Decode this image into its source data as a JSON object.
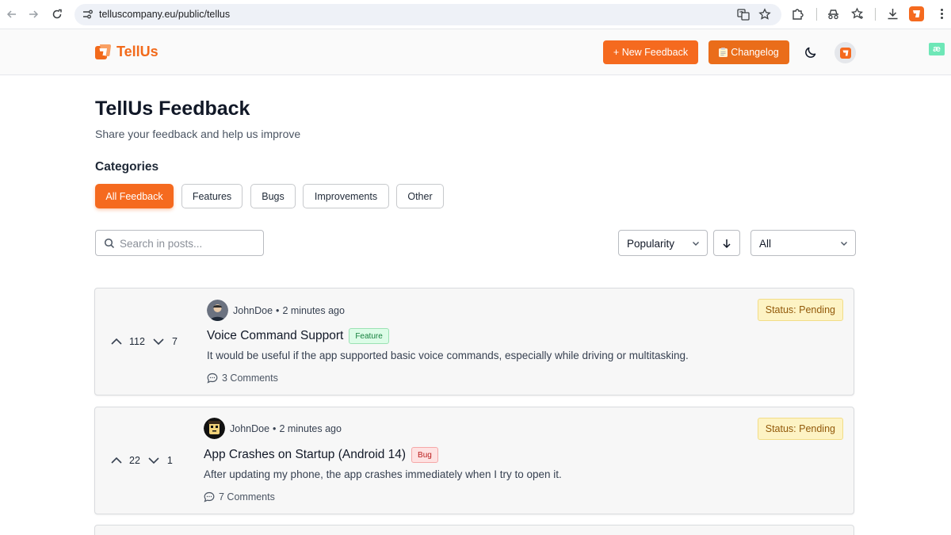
{
  "browser": {
    "url": "telluscompany.eu/public/tellus"
  },
  "header": {
    "brand": "TellUs",
    "new_feedback": "+ New Feedback",
    "changelog": "Changelog",
    "changelog_icon": "clipboard-icon",
    "theme_icon": "moon-icon"
  },
  "page": {
    "title": "TellUs Feedback",
    "subtitle": "Share your feedback and help us improve"
  },
  "categories": {
    "heading": "Categories",
    "items": [
      {
        "label": "All Feedback",
        "active": true
      },
      {
        "label": "Features",
        "active": false
      },
      {
        "label": "Bugs",
        "active": false
      },
      {
        "label": "Improvements",
        "active": false
      },
      {
        "label": "Other",
        "active": false
      }
    ]
  },
  "filters": {
    "search_placeholder": "Search in posts...",
    "sort_by": "Popularity",
    "status_filter": "All"
  },
  "posts": [
    {
      "upvotes": "112",
      "downvotes": "7",
      "author": "JohnDoe",
      "time": "2 minutes ago",
      "status": "Status: Pending",
      "title": "Voice Command Support",
      "tag": "Feature",
      "description": "It would be useful if the app supported basic voice commands, especially while driving or multitasking.",
      "comments": "3 Comments"
    },
    {
      "upvotes": "22",
      "downvotes": "1",
      "author": "JohnDoe",
      "time": "2 minutes ago",
      "status": "Status: Pending",
      "title": "App Crashes on Startup (Android 14)",
      "tag": "Bug",
      "description": "After updating my phone, the app crashes immediately when I try to open it.",
      "comments": "7 Comments"
    }
  ],
  "colors": {
    "accent": "#f56a1f",
    "status_bg": "#fdf3c4",
    "feature_tag": "#15803d",
    "bug_tag": "#b91c1c"
  }
}
